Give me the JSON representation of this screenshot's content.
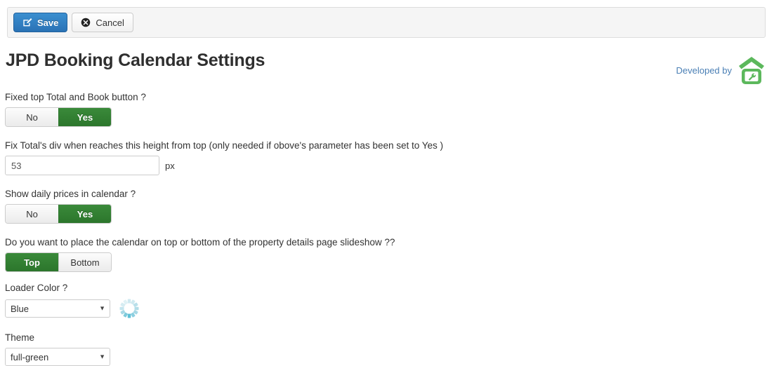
{
  "toolbar": {
    "save_label": "Save",
    "cancel_label": "Cancel",
    "save_icon": "pencil-square-icon",
    "cancel_icon": "x-circle-icon"
  },
  "header": {
    "title": "JPD Booking Calendar Settings",
    "developed_by_label": "Developed by",
    "logo_icon": "house-wrench-logo"
  },
  "colors": {
    "accent_green": "#2c762c",
    "save_blue": "#2a72b5",
    "link_blue": "#4a7fb5",
    "logo_green": "#5cb85c",
    "spinner_blue": "#a9d9e4"
  },
  "form": {
    "fields": [
      {
        "label": "Fixed top Total and Book button ?",
        "type": "toggle",
        "options": [
          "No",
          "Yes"
        ],
        "value": "Yes"
      },
      {
        "label": "Fix Total's div when reaches this height from top (only needed if obove's parameter has been set to Yes )",
        "type": "text",
        "value": "53",
        "placeholder": "",
        "unit": "px"
      },
      {
        "label": "Show daily prices in calendar ?",
        "type": "toggle",
        "options": [
          "No",
          "Yes"
        ],
        "value": "Yes"
      },
      {
        "label": "Do you want to place the calendar on top or bottom of the property details page slideshow ??",
        "type": "toggle",
        "options": [
          "Top",
          "Bottom"
        ],
        "value": "Top"
      },
      {
        "label": "Loader Color ?",
        "type": "select",
        "value": "Blue",
        "preview_icon": "loading-spinner-icon"
      },
      {
        "label": "Theme",
        "type": "select",
        "value": "full-green"
      }
    ]
  }
}
